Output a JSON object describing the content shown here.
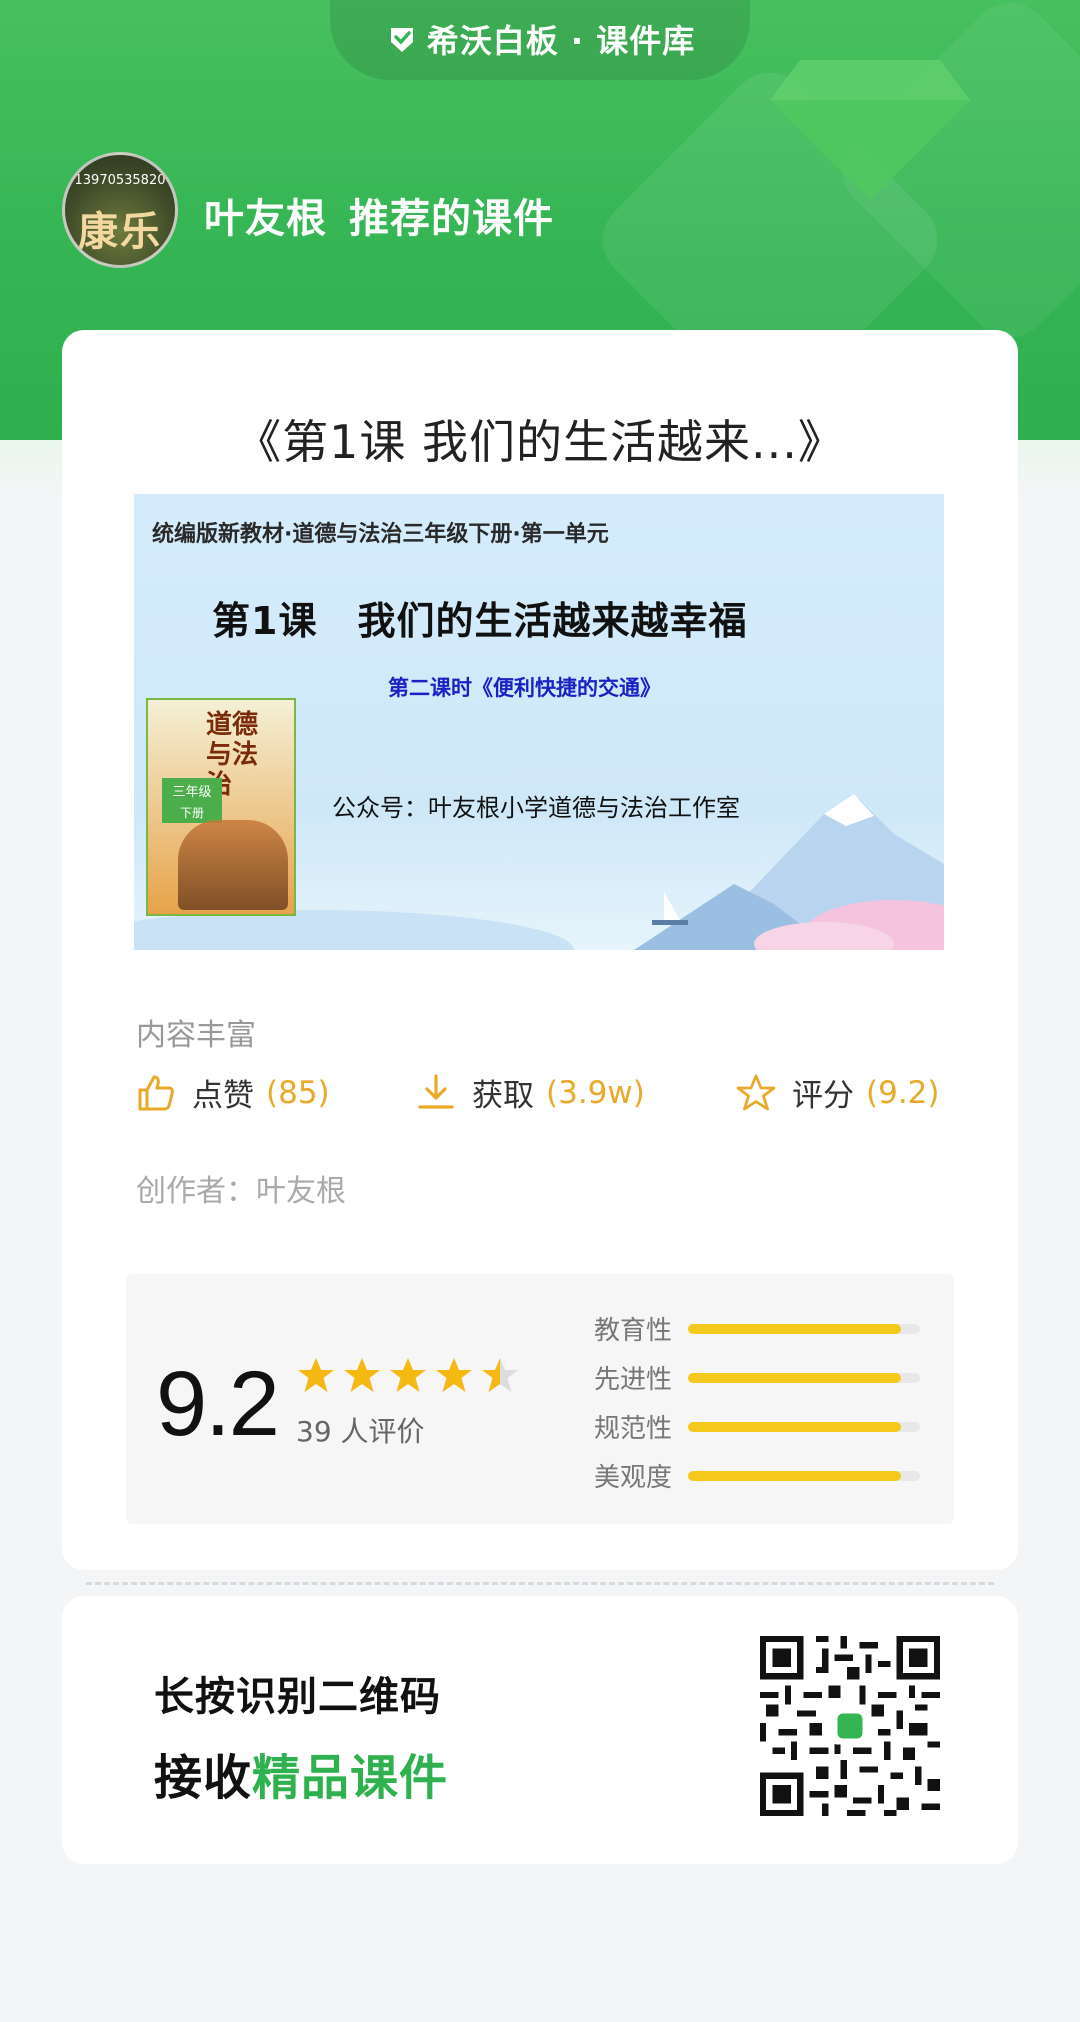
{
  "header": {
    "brand": "希沃白板 · 课件库",
    "avatar_text": "13970535820",
    "avatar_glyphs": "康乐",
    "recommender_name": "叶友根",
    "recommender_suffix": "推荐的课件"
  },
  "course": {
    "title": "《第1课 我们的生活越来...》",
    "cover": {
      "series": "统编版新教材·道德与法治三年级下册·第一单元",
      "lesson": "第1课",
      "lesson_title": "我们的生活越来越幸福",
      "sub_title": "第二课时《便利快捷的交通》",
      "publisher": "公众号：叶友根小学道德与法治工作室",
      "book_title": "道德与法治",
      "book_grade": "三年级",
      "book_term": "下册"
    },
    "tagline": "内容丰富",
    "stats": {
      "like_label": "点赞",
      "like_value": "(85)",
      "get_label": "获取",
      "get_value": "(3.9w)",
      "rate_label": "评分",
      "rate_value": "(9.2)"
    },
    "author_label": "创作者：",
    "author_name": "叶友根"
  },
  "rating": {
    "score": "9.2",
    "stars": 4.5,
    "count_text": "39 人评价",
    "dimensions": [
      {
        "label": "教育性",
        "level": 0.92
      },
      {
        "label": "先进性",
        "level": 0.92
      },
      {
        "label": "规范性",
        "level": 0.92
      },
      {
        "label": "美观度",
        "level": 0.92
      }
    ]
  },
  "qr": {
    "line1": "长按识别二维码",
    "line2_prefix": "接收",
    "line2_highlight": "精品课件"
  },
  "colors": {
    "brand_green": "#34b453",
    "accent_yellow": "#e9a929",
    "bar_yellow": "#f5c91c",
    "sub_title_blue": "#1b21c4"
  },
  "icons": {
    "brand_logo": "seewo-logo-icon",
    "like": "thumbs-up-icon",
    "get": "download-icon",
    "rate": "star-outline-icon"
  }
}
